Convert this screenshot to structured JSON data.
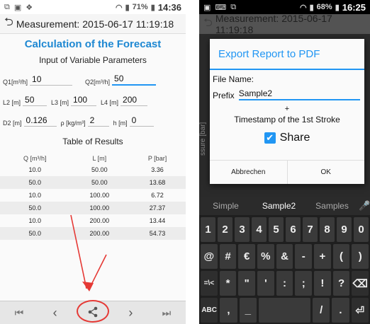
{
  "left": {
    "status_time": "14:36",
    "status_battery": "71%",
    "title": "Measurement: 2015-06-17 11:19:18",
    "heading": "Calculation of the Forecast",
    "subheading": "Input of Variable Parameters",
    "inputs": {
      "q1_label": "Q1[m³/h]",
      "q1": "10",
      "q2_label": "Q2[m³/h]",
      "q2": "50",
      "l2_label": "L2 [m]",
      "l2": "50",
      "l3_label": "L3 [m]",
      "l3": "100",
      "l4_label": "L4 [m]",
      "l4": "200",
      "d2_label": "D2 [m]",
      "d2": "0.126",
      "rho_label": "ρ [kg/m³]",
      "rho": "2",
      "h_label": "h [m]",
      "h": "0"
    },
    "table_title": "Table of Results",
    "table_headers": [
      "Q [m³/h]",
      "L [m]",
      "P [bar]"
    ],
    "table_rows": [
      [
        "10.0",
        "50.00",
        "3.36"
      ],
      [
        "50.0",
        "50.00",
        "13.68"
      ],
      [
        "10.0",
        "100.00",
        "6.72"
      ],
      [
        "50.0",
        "100.00",
        "27.37"
      ],
      [
        "10.0",
        "200.00",
        "13.44"
      ],
      [
        "50.0",
        "200.00",
        "54.73"
      ]
    ],
    "nav_icons": [
      "first-page-icon",
      "previous-icon",
      "share-icon",
      "next-icon",
      "last-page-icon"
    ]
  },
  "right": {
    "status_time": "16:25",
    "status_battery": "68%",
    "title": "Measurement: 2015-06-17 11:19:18",
    "side_label": "ssure [bar]",
    "dialog": {
      "title": "Export Report to PDF",
      "file_name_label": "File Name:",
      "prefix_label": "Prefix",
      "prefix_value": "Sample2",
      "plus": "+",
      "timestamp_text": "Timestamp of the 1st Stroke",
      "share_label": "Share",
      "cancel_label": "Abbrechen",
      "ok_label": "OK"
    },
    "keyboard": {
      "suggestions": [
        "Simple",
        "Sample2",
        "Samples"
      ],
      "row1": [
        "1",
        "2",
        "3",
        "4",
        "5",
        "6",
        "7",
        "8",
        "9",
        "0"
      ],
      "row2": [
        "@",
        "#",
        "€",
        "%",
        "&",
        "-",
        "+",
        "(",
        ")"
      ],
      "row3": [
        "=\\<",
        "*",
        "\"",
        "'",
        ":",
        ";",
        "!",
        "?"
      ],
      "row4_left": "ABC",
      "row4_keys": [
        ",",
        "_"
      ],
      "row4_right": [
        "/",
        "."
      ]
    }
  },
  "colors": {
    "accent": "#2196f3",
    "annotation_red": "#e53935"
  }
}
